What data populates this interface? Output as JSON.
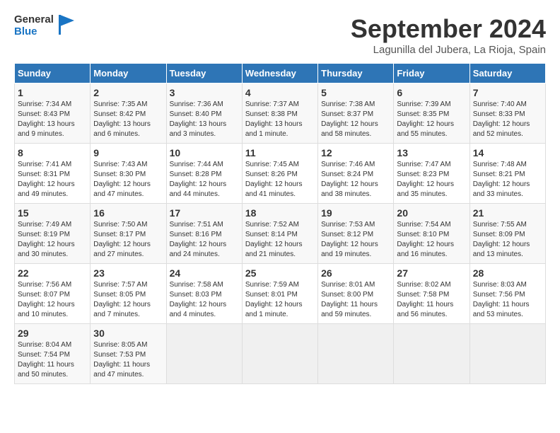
{
  "header": {
    "logo_line1": "General",
    "logo_line2": "Blue",
    "month": "September 2024",
    "location": "Lagunilla del Jubera, La Rioja, Spain"
  },
  "weekdays": [
    "Sunday",
    "Monday",
    "Tuesday",
    "Wednesday",
    "Thursday",
    "Friday",
    "Saturday"
  ],
  "weeks": [
    [
      {
        "day": "1",
        "rise": "7:34 AM",
        "set": "8:43 PM",
        "daylight": "13 hours and 9 minutes."
      },
      {
        "day": "2",
        "rise": "7:35 AM",
        "set": "8:42 PM",
        "daylight": "13 hours and 6 minutes."
      },
      {
        "day": "3",
        "rise": "7:36 AM",
        "set": "8:40 PM",
        "daylight": "13 hours and 3 minutes."
      },
      {
        "day": "4",
        "rise": "7:37 AM",
        "set": "8:38 PM",
        "daylight": "13 hours and 1 minute."
      },
      {
        "day": "5",
        "rise": "7:38 AM",
        "set": "8:37 PM",
        "daylight": "12 hours and 58 minutes."
      },
      {
        "day": "6",
        "rise": "7:39 AM",
        "set": "8:35 PM",
        "daylight": "12 hours and 55 minutes."
      },
      {
        "day": "7",
        "rise": "7:40 AM",
        "set": "8:33 PM",
        "daylight": "12 hours and 52 minutes."
      }
    ],
    [
      {
        "day": "8",
        "rise": "7:41 AM",
        "set": "8:31 PM",
        "daylight": "12 hours and 49 minutes."
      },
      {
        "day": "9",
        "rise": "7:43 AM",
        "set": "8:30 PM",
        "daylight": "12 hours and 47 minutes."
      },
      {
        "day": "10",
        "rise": "7:44 AM",
        "set": "8:28 PM",
        "daylight": "12 hours and 44 minutes."
      },
      {
        "day": "11",
        "rise": "7:45 AM",
        "set": "8:26 PM",
        "daylight": "12 hours and 41 minutes."
      },
      {
        "day": "12",
        "rise": "7:46 AM",
        "set": "8:24 PM",
        "daylight": "12 hours and 38 minutes."
      },
      {
        "day": "13",
        "rise": "7:47 AM",
        "set": "8:23 PM",
        "daylight": "12 hours and 35 minutes."
      },
      {
        "day": "14",
        "rise": "7:48 AM",
        "set": "8:21 PM",
        "daylight": "12 hours and 33 minutes."
      }
    ],
    [
      {
        "day": "15",
        "rise": "7:49 AM",
        "set": "8:19 PM",
        "daylight": "12 hours and 30 minutes."
      },
      {
        "day": "16",
        "rise": "7:50 AM",
        "set": "8:17 PM",
        "daylight": "12 hours and 27 minutes."
      },
      {
        "day": "17",
        "rise": "7:51 AM",
        "set": "8:16 PM",
        "daylight": "12 hours and 24 minutes."
      },
      {
        "day": "18",
        "rise": "7:52 AM",
        "set": "8:14 PM",
        "daylight": "12 hours and 21 minutes."
      },
      {
        "day": "19",
        "rise": "7:53 AM",
        "set": "8:12 PM",
        "daylight": "12 hours and 19 minutes."
      },
      {
        "day": "20",
        "rise": "7:54 AM",
        "set": "8:10 PM",
        "daylight": "12 hours and 16 minutes."
      },
      {
        "day": "21",
        "rise": "7:55 AM",
        "set": "8:09 PM",
        "daylight": "12 hours and 13 minutes."
      }
    ],
    [
      {
        "day": "22",
        "rise": "7:56 AM",
        "set": "8:07 PM",
        "daylight": "12 hours and 10 minutes."
      },
      {
        "day": "23",
        "rise": "7:57 AM",
        "set": "8:05 PM",
        "daylight": "12 hours and 7 minutes."
      },
      {
        "day": "24",
        "rise": "7:58 AM",
        "set": "8:03 PM",
        "daylight": "12 hours and 4 minutes."
      },
      {
        "day": "25",
        "rise": "7:59 AM",
        "set": "8:01 PM",
        "daylight": "12 hours and 1 minute."
      },
      {
        "day": "26",
        "rise": "8:01 AM",
        "set": "8:00 PM",
        "daylight": "11 hours and 59 minutes."
      },
      {
        "day": "27",
        "rise": "8:02 AM",
        "set": "7:58 PM",
        "daylight": "11 hours and 56 minutes."
      },
      {
        "day": "28",
        "rise": "8:03 AM",
        "set": "7:56 PM",
        "daylight": "11 hours and 53 minutes."
      }
    ],
    [
      {
        "day": "29",
        "rise": "8:04 AM",
        "set": "7:54 PM",
        "daylight": "11 hours and 50 minutes."
      },
      {
        "day": "30",
        "rise": "8:05 AM",
        "set": "7:53 PM",
        "daylight": "11 hours and 47 minutes."
      },
      null,
      null,
      null,
      null,
      null
    ]
  ]
}
